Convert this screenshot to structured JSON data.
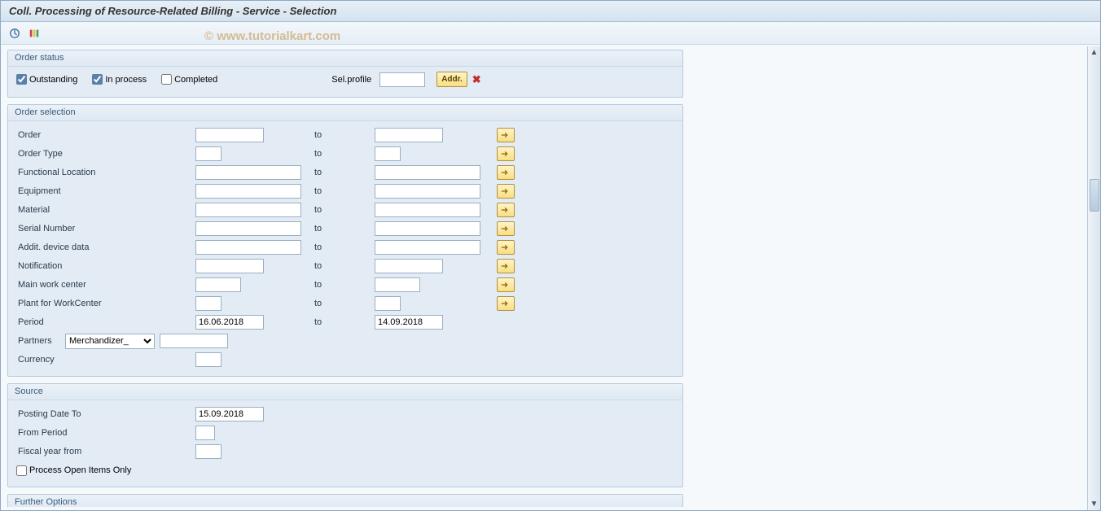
{
  "title": "Coll. Processing of Resource-Related Billing - Service - Selection",
  "watermark": "© www.tutorialkart.com",
  "toolbar": {
    "execute_alt": "Execute",
    "variant_alt": "Get Variant"
  },
  "status": {
    "group_title": "Order status",
    "outstanding_label": "Outstanding",
    "outstanding_checked": true,
    "inprocess_label": "In process",
    "inprocess_checked": true,
    "completed_label": "Completed",
    "completed_checked": false,
    "selprofile_label": "Sel.profile",
    "selprofile_value": "",
    "addr_btn": "Addr."
  },
  "selection": {
    "group_title": "Order selection",
    "to_label": "to",
    "rows": [
      {
        "label": "Order",
        "from": "",
        "to": "",
        "from_w": "m",
        "to_w": "m",
        "more": true
      },
      {
        "label": "Order Type",
        "from": "",
        "to": "",
        "from_w": "xs",
        "to_w": "xs",
        "more": true
      },
      {
        "label": "Functional Location",
        "from": "",
        "to": "",
        "from_w": "xl",
        "to_w": "xl",
        "more": true
      },
      {
        "label": "Equipment",
        "from": "",
        "to": "",
        "from_w": "xl",
        "to_w": "xl",
        "more": true
      },
      {
        "label": "Material",
        "from": "",
        "to": "",
        "from_w": "xl",
        "to_w": "xl",
        "more": true
      },
      {
        "label": "Serial Number",
        "from": "",
        "to": "",
        "from_w": "xl",
        "to_w": "xl",
        "more": true
      },
      {
        "label": "Addit. device data",
        "from": "",
        "to": "",
        "from_w": "xl",
        "to_w": "xl",
        "more": true
      },
      {
        "label": "Notification",
        "from": "",
        "to": "",
        "from_w": "m",
        "to_w": "m",
        "more": true
      },
      {
        "label": "Main work center",
        "from": "",
        "to": "",
        "from_w": "s",
        "to_w": "s",
        "more": true
      },
      {
        "label": "Plant for WorkCenter",
        "from": "",
        "to": "",
        "from_w": "xs",
        "to_w": "xs",
        "more": true
      },
      {
        "label": "Period",
        "from": "16.06.2018",
        "to": "14.09.2018",
        "from_w": "m",
        "to_w": "m",
        "more": false
      }
    ],
    "partners_label": "Partners",
    "partners_selected": "Merchandizer_",
    "partners_value": "",
    "currency_label": "Currency",
    "currency_value": ""
  },
  "source": {
    "group_title": "Source",
    "posting_date_label": "Posting Date To",
    "posting_date_value": "15.09.2018",
    "from_period_label": "From Period",
    "from_period_value": "",
    "fiscal_year_label": "Fiscal year from",
    "fiscal_year_value": "",
    "process_open_label": "Process Open Items Only",
    "process_open_checked": false
  },
  "further": {
    "group_title": "Further Options"
  }
}
